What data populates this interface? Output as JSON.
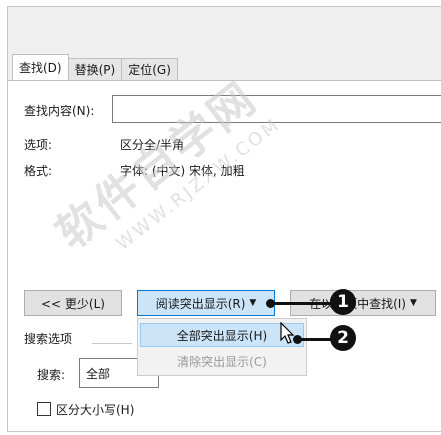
{
  "tabs": [
    {
      "label": "查找(D)"
    },
    {
      "label": "替换(P)"
    },
    {
      "label": "定位(G)"
    }
  ],
  "find": {
    "label": "查找内容(N):",
    "value": ""
  },
  "options": {
    "options_label": "选项:",
    "options_value": "区分全/半角",
    "format_label": "格式:",
    "format_value": "字体: (中文) 宋体, 加粗"
  },
  "buttons": {
    "less": "<< 更少(L)",
    "reading_highlight": "阅读突出显示(R)",
    "find_in": "在以下项中查找(I)"
  },
  "dropdown_menu": {
    "highlight_all": "全部突出显示(H)",
    "clear_highlight": "清除突出显示(C)"
  },
  "search_options": {
    "section_label": "搜索选项",
    "search_label": "搜索:",
    "search_value": "全部",
    "match_case_label": "区分大小写(H)"
  },
  "callouts": [
    "1",
    "2"
  ],
  "watermark": {
    "text": "软件自学网",
    "url": "WWW.RJZXW.COM"
  }
}
